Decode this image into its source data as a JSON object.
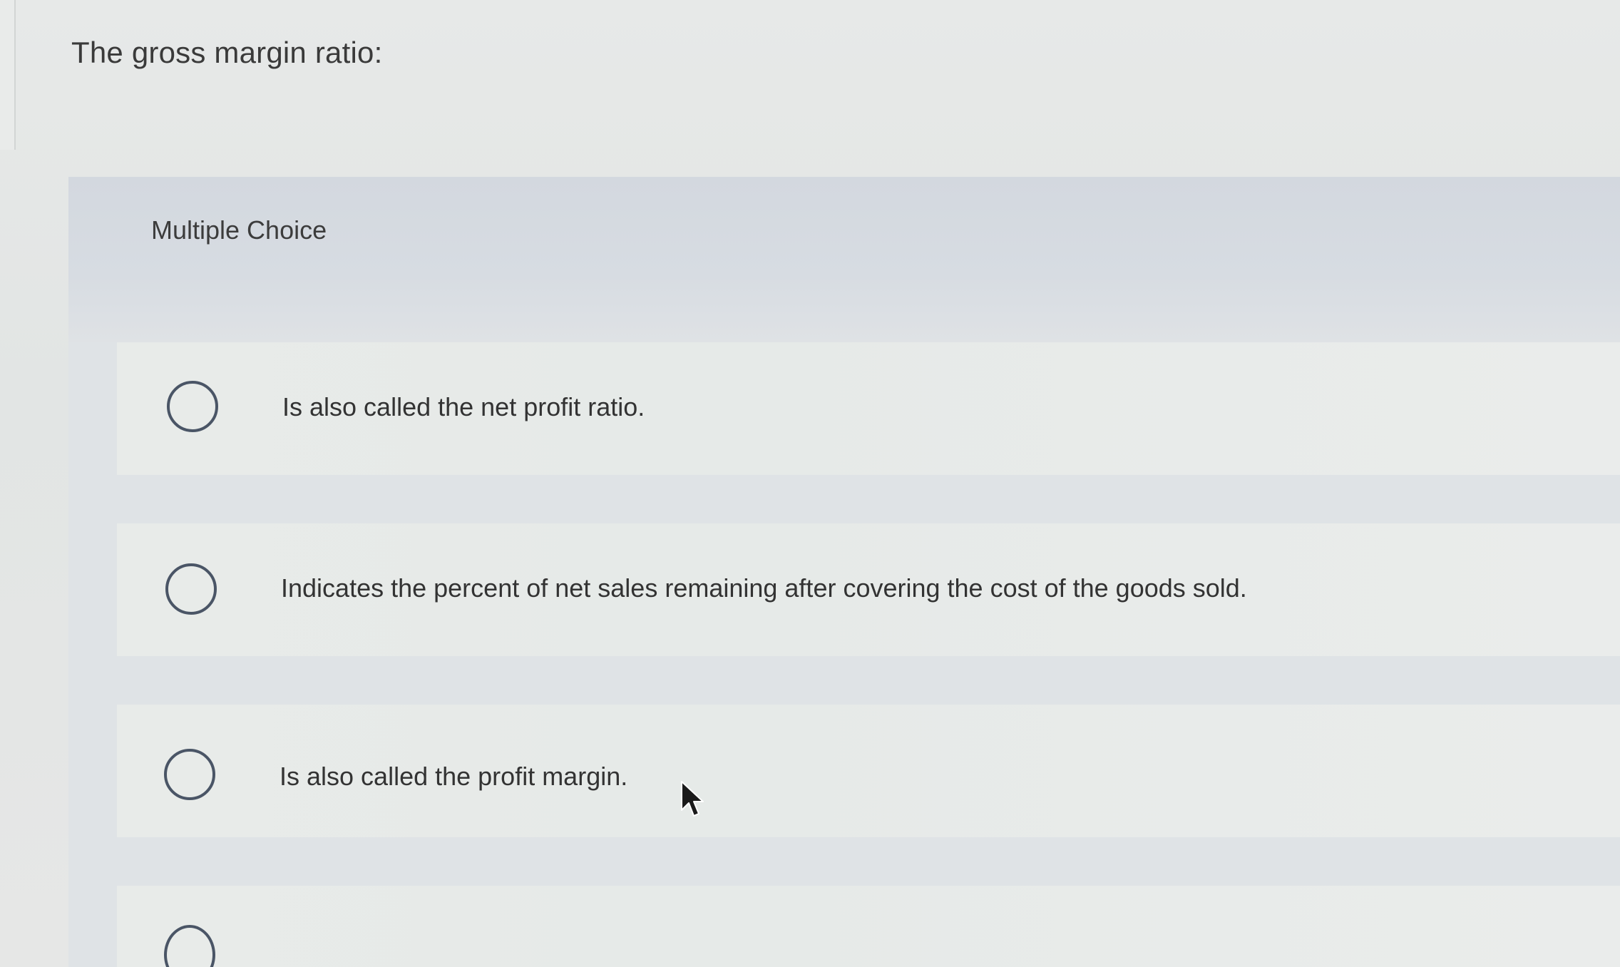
{
  "question": {
    "text": "The gross margin ratio:"
  },
  "section": {
    "label": "Multiple Choice"
  },
  "choices": [
    {
      "text": "Is also called the net profit ratio."
    },
    {
      "text": "Indicates the percent of net sales remaining after covering the cost of the goods sold."
    },
    {
      "text": "Is also called the profit margin."
    },
    {
      "text": ""
    }
  ],
  "colors": {
    "background": "#e4e6e5",
    "header_band": "#d5dae0",
    "radio_border": "#4a5566",
    "text": "#333333"
  },
  "icons": {
    "cursor": "mouse-pointer-icon",
    "radio": "radio-circle-icon"
  }
}
